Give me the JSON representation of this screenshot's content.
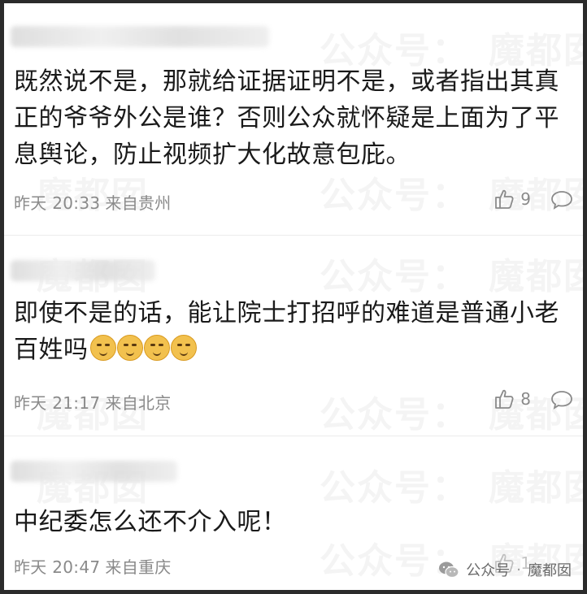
{
  "watermark": {
    "text_a": "公众号：",
    "text_b": "魔都囡"
  },
  "comments": [
    {
      "text": "既然说不是，那就给证据证明不是，或者指出其真正的爷爷外公是谁？否则公众就怀疑是上面为了平息舆论，防止视频扩大化故意包庇。",
      "time": "昨天 20:33",
      "location": "来自贵州",
      "likes": "9",
      "emoji_count": 0
    },
    {
      "text": "即使不是的话，能让院士打招呼的难道是普通小老百姓吗",
      "time": "昨天 21:17",
      "location": "来自北京",
      "likes": "8",
      "emoji_count": 4
    },
    {
      "text": "中纪委怎么还不介入呢！",
      "time": "昨天 20:47",
      "location": "来自重庆",
      "likes": "1",
      "emoji_count": 0
    }
  ],
  "badge": {
    "account_label": "公众号",
    "separator": "·",
    "name": "魔都囡"
  },
  "icons": {
    "like": "thumbs-up-icon",
    "reply": "comment-bubble-icon",
    "wechat": "wechat-icon",
    "emoji": "doge-emoji-icon"
  },
  "colors": {
    "text": "#1a1a1a",
    "meta": "#8a8a8a",
    "divider": "#ececec"
  }
}
